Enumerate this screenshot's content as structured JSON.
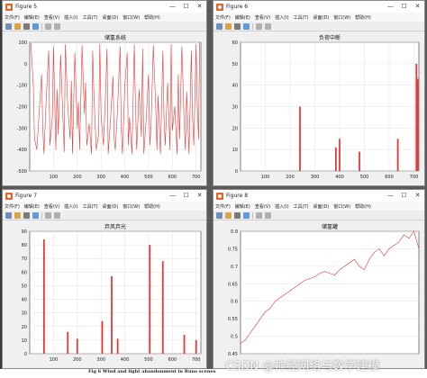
{
  "windows": [
    {
      "id": "fig5",
      "title": "Figure 5",
      "menus": [
        "文件(F)",
        "编辑(E)",
        "查看(V)",
        "插入(I)",
        "工具(T)",
        "桌面(D)",
        "窗口(W)",
        "帮助(H)"
      ],
      "chart_title": "储氢系统",
      "yticks": [
        "100",
        "0",
        "-100",
        "-200",
        "-300",
        "-400",
        "-500"
      ],
      "xticks": [
        "100",
        "200",
        "300",
        "400",
        "500",
        "600",
        "700"
      ]
    },
    {
      "id": "fig6",
      "title": "Figure 6",
      "menus": [
        "文件(F)",
        "编辑(E)",
        "查看(V)",
        "插入(I)",
        "工具(T)",
        "桌面(D)",
        "窗口(W)",
        "帮助(H)"
      ],
      "chart_title": "负荷中断",
      "yticks": [
        "60",
        "50",
        "40",
        "30",
        "20",
        "10",
        "0"
      ],
      "xticks": [
        "100",
        "200",
        "300",
        "400",
        "500",
        "600",
        "700"
      ]
    },
    {
      "id": "fig7",
      "title": "Figure 7",
      "menus": [
        "文件(F)",
        "编辑(E)",
        "查看(V)",
        "插入(I)",
        "工具(T)",
        "桌面(D)",
        "窗口(W)",
        "帮助(H)"
      ],
      "chart_title": "弃风弃光",
      "yticks": [
        "90",
        "80",
        "70",
        "60",
        "50",
        "40",
        "30",
        "20",
        "10",
        "0"
      ],
      "xticks": [
        "100",
        "200",
        "300",
        "400",
        "500",
        "600",
        "700"
      ]
    },
    {
      "id": "fig8",
      "title": "Figure 8",
      "menus": [
        "文件(F)",
        "编辑(E)",
        "查看(V)",
        "插入(I)",
        "工具(T)",
        "桌面(D)",
        "窗口(W)",
        "帮助(H)"
      ],
      "chart_title": "储氢罐",
      "yticks": [
        "0.8",
        "0.75",
        "0.7",
        "0.65",
        "0.6",
        "0.55",
        "0.5",
        "0.45"
      ],
      "xticks": []
    }
  ],
  "window_buttons": {
    "minimize": "—",
    "maximize": "☐",
    "close": "✕"
  },
  "caption": "Fig 6   Wind and light abandonment in Runs scenes",
  "watermark": "CSDN @神经网络与数学建模",
  "colors": {
    "line": "#e63838",
    "axes_bg": "#ffffff",
    "grid": "#e2e2e2",
    "figure_bg": "#f0f0f0"
  },
  "chart_data": [
    {
      "type": "line",
      "title": "储氢系统",
      "xlim": [
        0,
        720
      ],
      "ylim": [
        -500,
        100
      ],
      "grid": true,
      "series": [
        {
          "x": [
            5,
            15,
            20,
            30,
            40,
            50,
            55,
            60,
            70,
            80,
            85,
            95,
            100,
            110,
            115,
            120,
            130,
            140,
            145,
            150,
            160,
            170,
            175,
            180,
            190,
            200,
            205,
            210,
            220,
            230,
            235,
            240,
            250,
            260,
            265,
            270,
            280,
            290,
            295,
            300,
            310,
            320,
            325,
            330,
            340,
            350,
            355,
            360,
            370,
            380,
            385,
            390,
            400,
            410,
            415,
            420,
            430,
            440,
            445,
            450,
            460,
            470,
            475,
            480,
            490,
            500,
            505,
            510,
            520,
            530,
            535,
            540,
            550,
            560,
            565,
            570,
            580,
            590,
            595,
            600,
            610,
            620,
            625,
            630,
            640,
            650,
            655,
            660,
            670,
            680,
            685,
            690,
            700,
            705,
            710,
            715
          ],
          "y": [
            95,
            -100,
            -350,
            -400,
            -220,
            -50,
            -300,
            -420,
            -150,
            60,
            -380,
            -250,
            80,
            -400,
            -120,
            -330,
            40,
            -260,
            -410,
            90,
            -200,
            -350,
            -80,
            -420,
            50,
            -300,
            -180,
            -400,
            85,
            -230,
            -90,
            -380,
            -280,
            -420,
            60,
            -150,
            -400,
            -330,
            90,
            -240,
            -380,
            -120,
            70,
            -420,
            -260,
            -60,
            -350,
            -400,
            -200,
            80,
            -310,
            -420,
            -100,
            50,
            -380,
            -250,
            -420,
            90,
            -200,
            -400,
            -120,
            -340,
            70,
            -420,
            -260,
            -50,
            -380,
            -300,
            85,
            -200,
            -400,
            -150,
            -420,
            60,
            -260,
            -380,
            -90,
            -400,
            90,
            -310,
            -200,
            -420,
            -50,
            -350,
            80,
            -280,
            -400,
            -130,
            -420,
            60,
            -250,
            -380,
            90,
            -200,
            -350,
            100
          ]
        }
      ]
    },
    {
      "type": "bar",
      "title": "负荷中断",
      "xlim": [
        0,
        720
      ],
      "ylim": [
        0,
        60
      ],
      "grid": true,
      "series": [
        {
          "x": [
            240,
            385,
            400,
            480,
            635,
            710,
            715
          ],
          "y": [
            30,
            11,
            15,
            9,
            15,
            50,
            43
          ]
        }
      ]
    },
    {
      "type": "bar",
      "title": "弃风弃光",
      "xlim": [
        0,
        720
      ],
      "ylim": [
        0,
        90
      ],
      "grid": true,
      "series": [
        {
          "x": [
            60,
            160,
            200,
            305,
            345,
            370,
            505,
            560,
            650,
            700
          ],
          "y": [
            84,
            16,
            11,
            24,
            57,
            11,
            80,
            68,
            14,
            10
          ]
        }
      ]
    },
    {
      "type": "line",
      "title": "储氢罐",
      "xlim": [
        0,
        720
      ],
      "ylim": [
        0.45,
        0.8
      ],
      "grid": true,
      "series": [
        {
          "x": [
            0,
            20,
            40,
            60,
            80,
            100,
            120,
            140,
            160,
            180,
            200,
            220,
            240,
            260,
            280,
            300,
            320,
            340,
            360,
            380,
            400,
            420,
            440,
            460,
            480,
            500,
            520,
            540,
            560,
            580,
            600,
            620,
            640,
            660,
            680,
            700,
            720
          ],
          "y": [
            0.48,
            0.49,
            0.51,
            0.53,
            0.55,
            0.57,
            0.58,
            0.6,
            0.61,
            0.62,
            0.63,
            0.64,
            0.65,
            0.66,
            0.665,
            0.67,
            0.68,
            0.685,
            0.68,
            0.675,
            0.69,
            0.7,
            0.71,
            0.72,
            0.7,
            0.69,
            0.72,
            0.74,
            0.75,
            0.73,
            0.75,
            0.76,
            0.77,
            0.79,
            0.78,
            0.8,
            0.75
          ]
        }
      ]
    }
  ]
}
